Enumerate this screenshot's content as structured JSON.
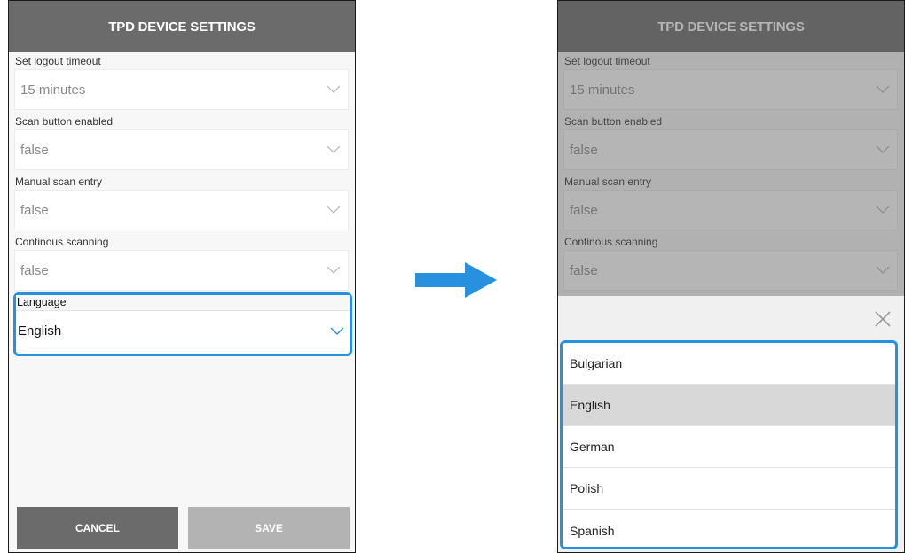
{
  "left_screen": {
    "header_title": "TPD DEVICE SETTINGS",
    "fields": [
      {
        "label": "Set logout timeout",
        "value": "15 minutes"
      },
      {
        "label": "Scan button enabled",
        "value": "false"
      },
      {
        "label": "Manual scan entry",
        "value": "false"
      },
      {
        "label": "Continous scanning",
        "value": "false"
      }
    ],
    "language": {
      "label": "Language",
      "value": "English"
    },
    "cancel_label": "CANCEL",
    "save_label": "SAVE"
  },
  "right_screen": {
    "header_title": "TPD DEVICE SETTINGS",
    "fields": [
      {
        "label": "Set logout timeout",
        "value": "15 minutes"
      },
      {
        "label": "Scan button enabled",
        "value": "false"
      },
      {
        "label": "Manual scan entry",
        "value": "false"
      },
      {
        "label": "Continous scanning",
        "value": "false"
      }
    ],
    "language_options": [
      "Bulgarian",
      "English",
      "German",
      "Polish",
      "Spanish"
    ],
    "selected_language": "English"
  },
  "colors": {
    "header_bg": "#6b6b6b",
    "highlight_border": "#2791e0",
    "arrow": "#2791e0",
    "selected_option_bg": "#d8d8d8",
    "save_button_bg": "#b3b3b3"
  },
  "icons": {
    "dropdown": "chevron-down-icon",
    "close": "close-icon",
    "transition": "right-arrow-icon"
  }
}
